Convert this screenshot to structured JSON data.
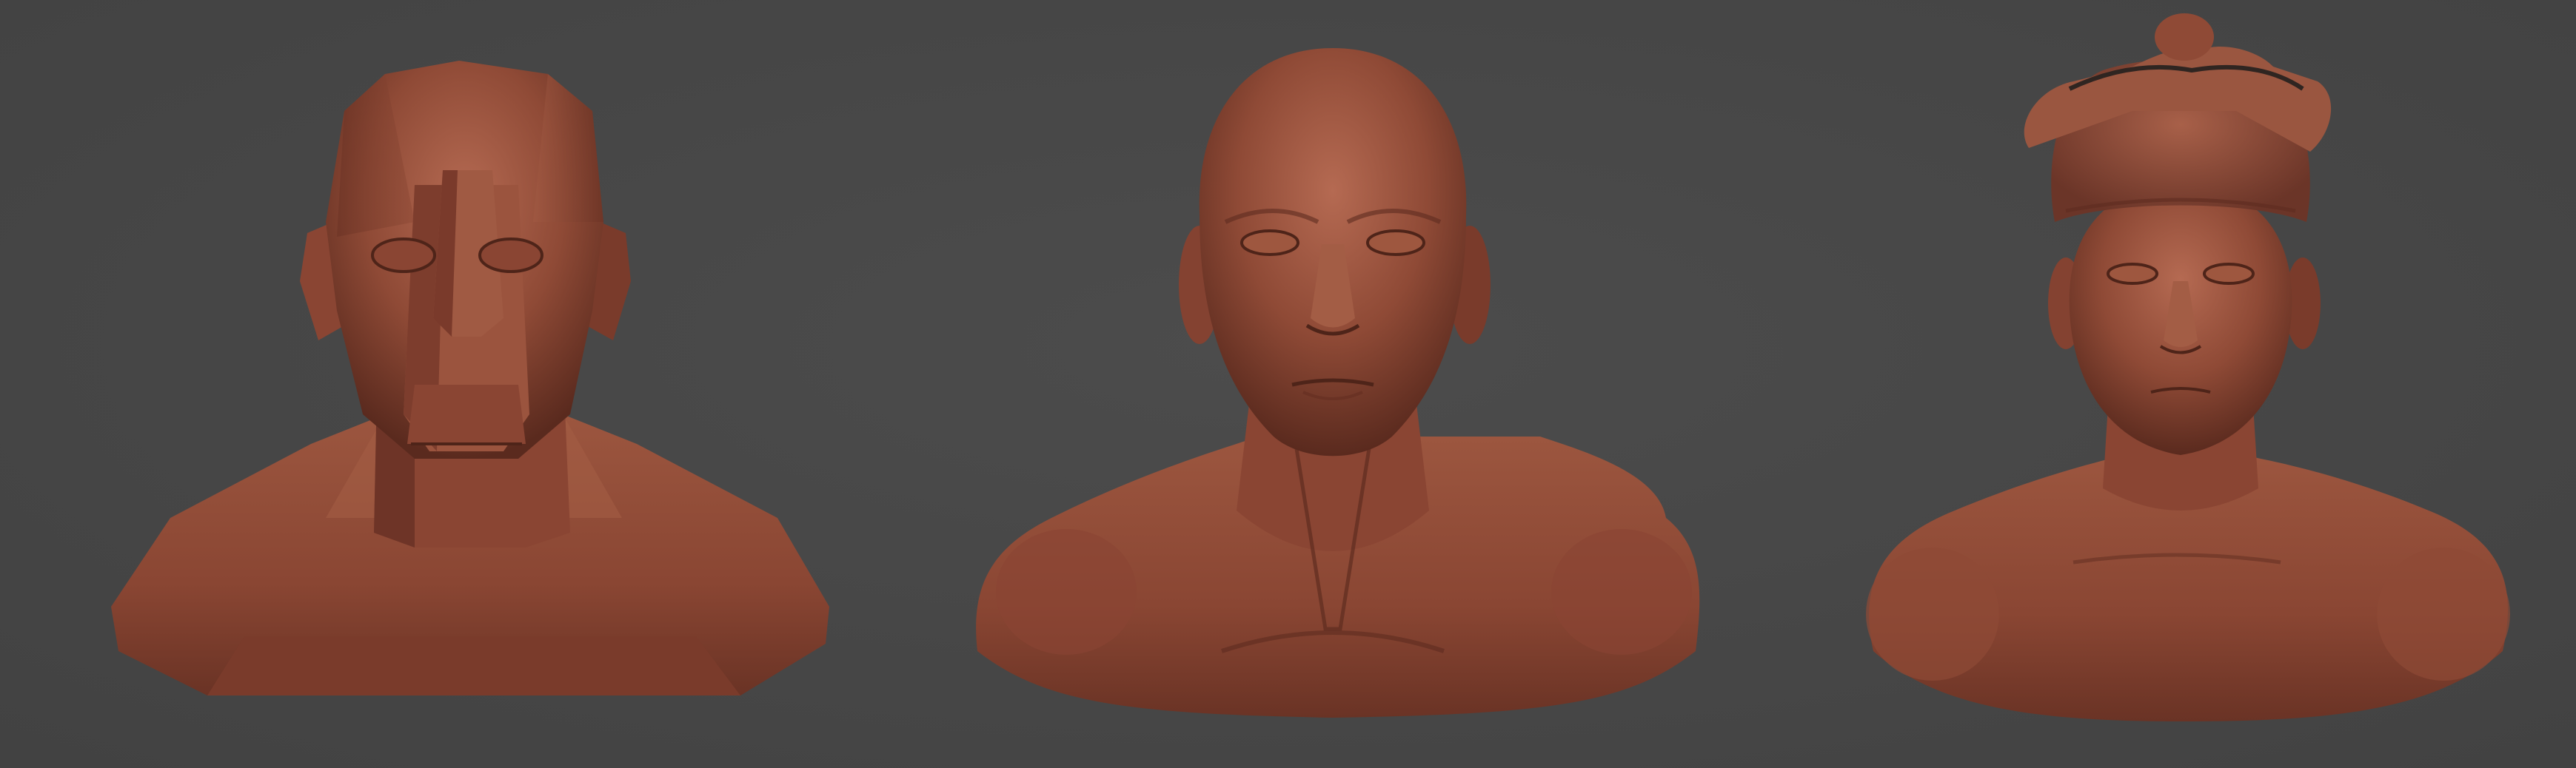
{
  "scene": {
    "background_color": "#474747",
    "clay_color": "#8f4a36",
    "clay_highlight": "#b56a52",
    "clay_shadow": "#5a2a1e",
    "busts": [
      {
        "name": "planar-head-bust",
        "style": "blocky planar"
      },
      {
        "name": "anatomical-head-bust",
        "style": "refined anatomy"
      },
      {
        "name": "detailed-head-bust-with-headwrap",
        "style": "detailed with cloth headwrap"
      }
    ]
  }
}
